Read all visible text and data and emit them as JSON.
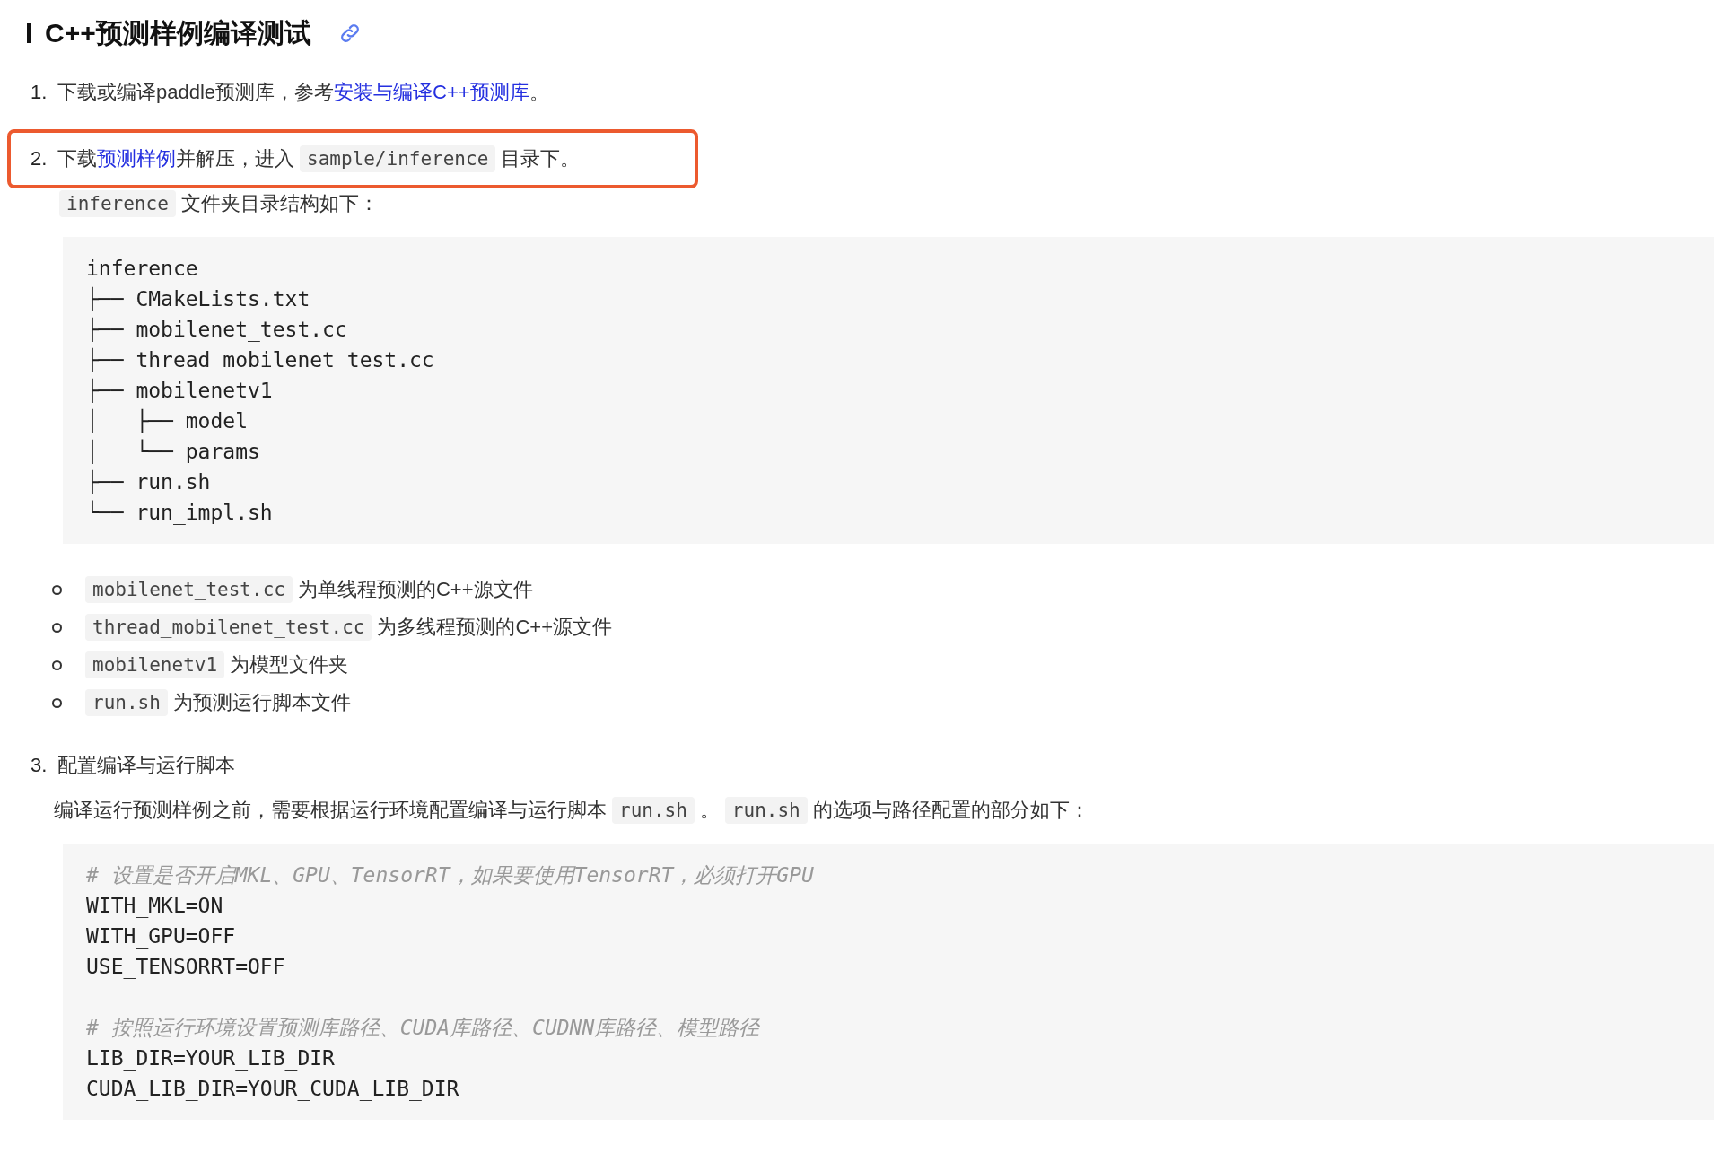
{
  "heading": {
    "title": "C++预测样例编译测试"
  },
  "steps": [
    {
      "number": "1.",
      "highlighted": false,
      "parts": [
        {
          "kind": "text",
          "text": "下载或编译paddle预测库，参考"
        },
        {
          "kind": "link",
          "text": "安装与编译C++预测库"
        },
        {
          "kind": "text",
          "text": "。"
        }
      ]
    },
    {
      "number": "2.",
      "highlighted": true,
      "parts": [
        {
          "kind": "text",
          "text": "下载"
        },
        {
          "kind": "link",
          "text": "预测样例"
        },
        {
          "kind": "text",
          "text": "并解压，进入"
        },
        {
          "kind": "code",
          "text": "sample/inference"
        },
        {
          "kind": "text",
          "text": "目录下。"
        }
      ],
      "blocks": [
        {
          "kind": "paragraph",
          "parts": [
            {
              "kind": "code",
              "text": "inference"
            },
            {
              "kind": "text",
              "text": "文件夹目录结构如下："
            }
          ]
        },
        {
          "kind": "code",
          "lines": [
            {
              "kind": "code",
              "text": "inference"
            },
            {
              "kind": "code",
              "text": "├── CMakeLists.txt"
            },
            {
              "kind": "code",
              "text": "├── mobilenet_test.cc"
            },
            {
              "kind": "code",
              "text": "├── thread_mobilenet_test.cc"
            },
            {
              "kind": "code",
              "text": "├── mobilenetv1"
            },
            {
              "kind": "code",
              "text": "│   ├── model"
            },
            {
              "kind": "code",
              "text": "│   └── params"
            },
            {
              "kind": "code",
              "text": "├── run.sh"
            },
            {
              "kind": "code",
              "text": "└── run_impl.sh"
            }
          ]
        },
        {
          "kind": "bullets",
          "items": [
            {
              "parts": [
                {
                  "kind": "code",
                  "text": "mobilenet_test.cc"
                },
                {
                  "kind": "text",
                  "text": "为单线程预测的C++源文件"
                }
              ]
            },
            {
              "parts": [
                {
                  "kind": "code",
                  "text": "thread_mobilenet_test.cc"
                },
                {
                  "kind": "text",
                  "text": "为多线程预测的C++源文件"
                }
              ]
            },
            {
              "parts": [
                {
                  "kind": "code",
                  "text": "mobilenetv1"
                },
                {
                  "kind": "text",
                  "text": "为模型文件夹"
                }
              ]
            },
            {
              "parts": [
                {
                  "kind": "code",
                  "text": "run.sh"
                },
                {
                  "kind": "text",
                  "text": "为预测运行脚本文件"
                }
              ]
            }
          ]
        }
      ]
    },
    {
      "number": "3.",
      "highlighted": false,
      "parts": [
        {
          "kind": "text",
          "text": "配置编译与运行脚本"
        }
      ],
      "blocks": [
        {
          "kind": "paragraph",
          "parts": [
            {
              "kind": "text",
              "text": "编译运行预测样例之前，需要根据运行环境配置编译与运行脚本"
            },
            {
              "kind": "code",
              "text": "run.sh"
            },
            {
              "kind": "text",
              "text": "。"
            },
            {
              "kind": "code",
              "text": "run.sh"
            },
            {
              "kind": "text",
              "text": "的选项与路径配置的部分如下："
            }
          ]
        },
        {
          "kind": "code",
          "lines": [
            {
              "kind": "comment",
              "text": "# 设置是否开启MKL、GPU、TensorRT，如果要使用TensorRT，必须打开GPU"
            },
            {
              "kind": "code",
              "text": "WITH_MKL=ON"
            },
            {
              "kind": "code",
              "text": "WITH_GPU=OFF"
            },
            {
              "kind": "code",
              "text": "USE_TENSORRT=OFF"
            },
            {
              "kind": "blank"
            },
            {
              "kind": "comment",
              "text": "# 按照运行环境设置预测库路径、CUDA库路径、CUDNN库路径、模型路径"
            },
            {
              "kind": "code",
              "text": "LIB_DIR=YOUR_LIB_DIR"
            },
            {
              "kind": "code",
              "text": "CUDA_LIB_DIR=YOUR_CUDA_LIB_DIR"
            }
          ]
        }
      ]
    }
  ]
}
